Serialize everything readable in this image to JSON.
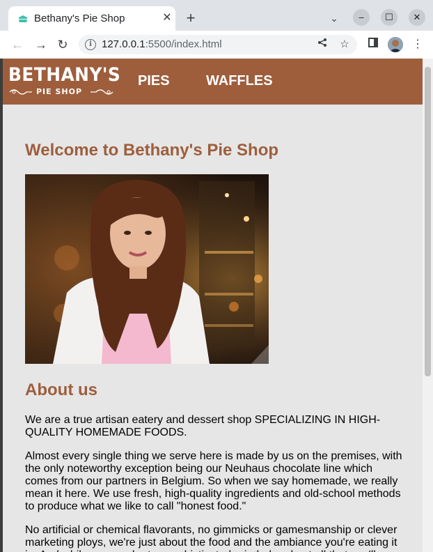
{
  "browser": {
    "tab_title": "Bethany's Pie Shop",
    "url_host": "127.0.0.1",
    "url_rest": ":5500/index.html"
  },
  "site": {
    "logo_main": "BETHANY'S",
    "logo_sub": "PIE SHOP",
    "nav": [
      "PIES",
      "WAFFLES"
    ],
    "welcome_heading": "Welcome to Bethany's Pie Shop",
    "about_heading": "About us",
    "paragraphs": [
      "We are a true artisan eatery and dessert shop SPECIALIZING IN HIGH-QUALITY HOMEMADE FOODS.",
      "Almost every single thing we serve here is made by us on the premises, with the only noteworthy exception being our Neuhaus chocolate line which comes from our partners in Belgium. So when we say homemade, we really mean it here. We use fresh, high-quality ingredients and old-school methods to produce what we like to call \"honest food.\"",
      "No artificial or chemical flavorants, no gimmicks or gamesmanship or clever marketing ploys, we're just about the food and the ambiance you're eating it in. And while we may be too sophisticated-minded and not all that you'll"
    ]
  },
  "colors": {
    "brand": "#9e5e3c",
    "page_bg": "#e6e6e6"
  }
}
